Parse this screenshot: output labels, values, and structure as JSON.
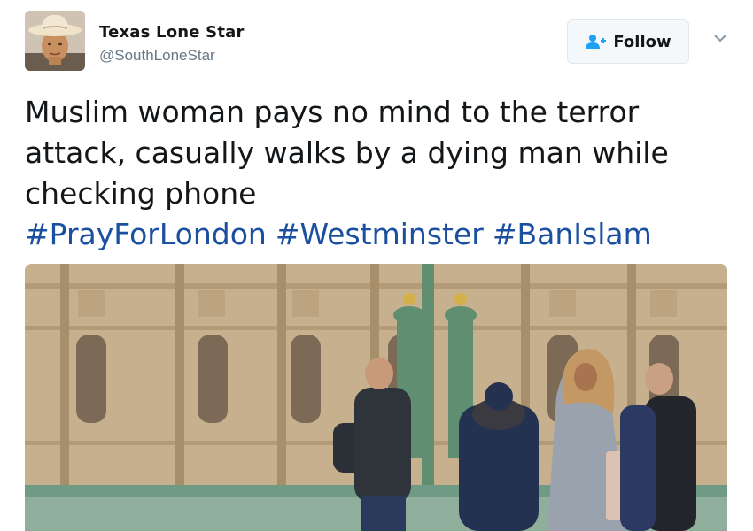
{
  "author": {
    "display_name": "Texas Lone Star",
    "handle": "@SouthLoneStar",
    "avatar_icon": "avatar-cowboy-hat-icon"
  },
  "follow_button": {
    "label": "Follow",
    "icon": "follow-user-icon"
  },
  "menu_caret": {
    "icon": "chevron-down-icon"
  },
  "tweet": {
    "text": "Muslim woman pays no mind to the terror attack, casually walks by a dying man while checking phone",
    "hashtags": [
      "#PrayForLondon",
      "#Westminster",
      "#BanIslam"
    ]
  },
  "colors": {
    "text": "#14171a",
    "secondary": "#657786",
    "link": "#1b4fa0",
    "follow_icon": "#1da1f2",
    "button_bg": "#f5f8fa",
    "button_border": "#e1e8ed"
  }
}
